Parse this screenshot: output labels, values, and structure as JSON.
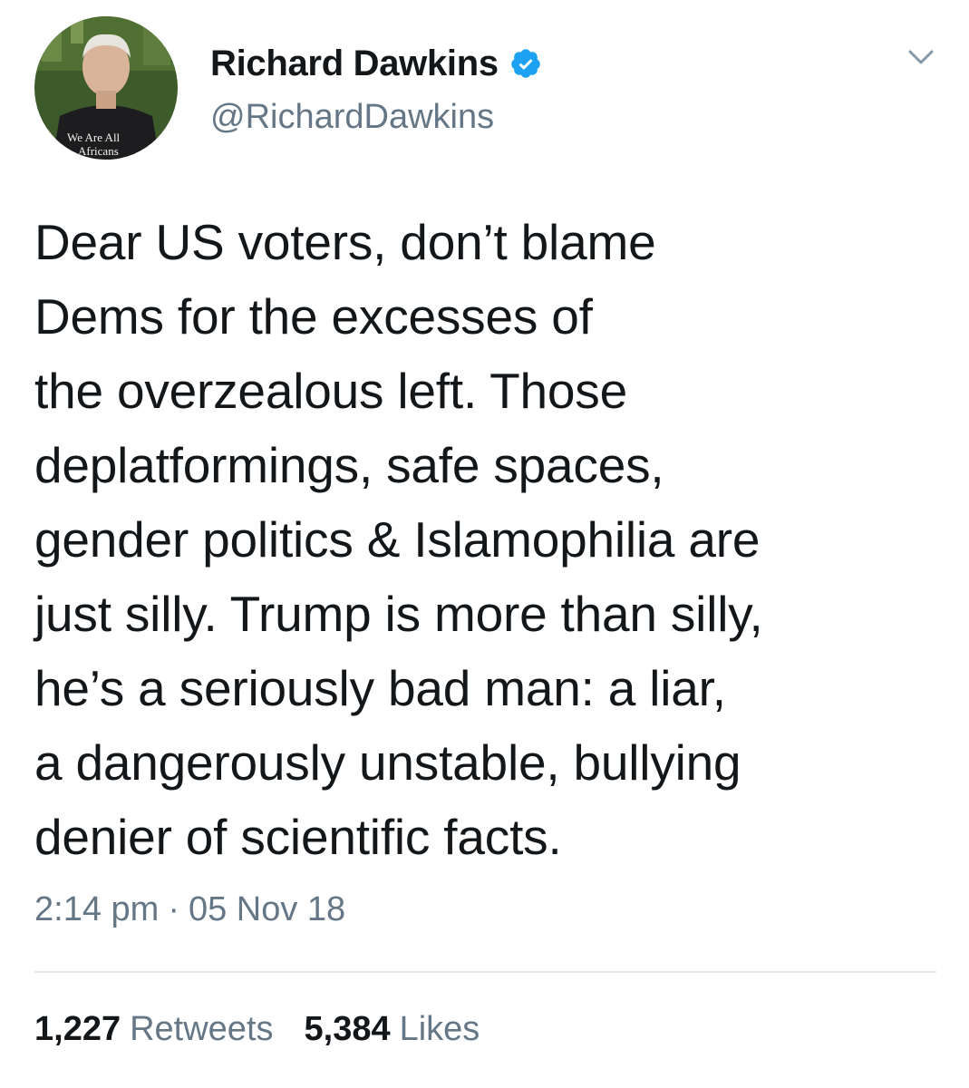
{
  "tweet": {
    "author": {
      "display_name": "Richard Dawkins",
      "handle": "@RichardDawkins",
      "verified": true,
      "avatar_shirt_text": [
        "We Are All",
        "Africans"
      ]
    },
    "text": "Dear US voters, don’t blame\nDems for the excesses of\nthe overzealous left. Those\ndeplatformings, safe spaces,\ngender politics & Islamophilia are\njust silly. Trump is more than silly,\nhe’s a seriously bad man: a liar,\na dangerously unstable, bullying\ndenier of scientific facts.",
    "time": "2:14 pm",
    "separator": "·",
    "date": "05 Nov 18",
    "retweets": {
      "count": "1,227",
      "label": "Retweets"
    },
    "likes": {
      "count": "5,384",
      "label": "Likes"
    }
  },
  "icons": {
    "verified": "verified-badge-icon",
    "menu": "chevron-down-icon"
  },
  "colors": {
    "text_primary": "#14171a",
    "text_secondary": "#657786",
    "verified_blue": "#1da1f2",
    "divider": "#e1e8ed"
  }
}
